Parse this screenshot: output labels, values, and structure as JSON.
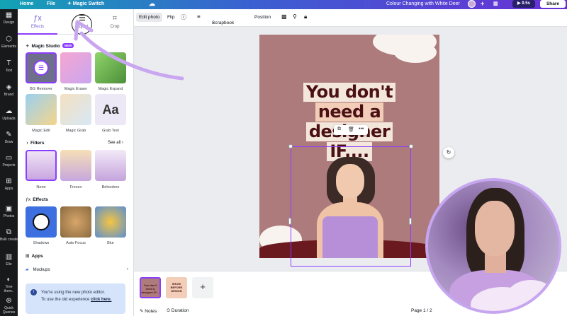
{
  "topbar": {
    "home": "Home",
    "file": "File",
    "magic_switch": "✦ Magic Switch",
    "doc_title": "Colour Changing with White Deer",
    "timer": "▶ 9.5s",
    "share": "Share"
  },
  "rail": [
    {
      "icon": "▦",
      "label": "Design"
    },
    {
      "icon": "⬡",
      "label": "Elements"
    },
    {
      "icon": "T",
      "label": "Text"
    },
    {
      "icon": "◈",
      "label": "Brand"
    },
    {
      "icon": "☁",
      "label": "Uploads"
    },
    {
      "icon": "✎",
      "label": "Draw"
    },
    {
      "icon": "▭",
      "label": "Projects"
    },
    {
      "icon": "⊞",
      "label": "Apps"
    },
    {
      "icon": "▣",
      "label": "Photos"
    },
    {
      "icon": "⧉",
      "label": "Bulk create"
    },
    {
      "icon": "▥",
      "label": "Elie"
    },
    {
      "icon": "◐",
      "label": "Tree them.."
    },
    {
      "icon": "⊛",
      "label": "Quick Queries"
    }
  ],
  "panel": {
    "tabs": [
      {
        "icon": "ƒx",
        "label": "Effects"
      },
      {
        "icon": "☰",
        "label": "Adjust"
      },
      {
        "icon": "⌗",
        "label": "Crop"
      }
    ],
    "magic_studio": {
      "title": "Magic Studio",
      "badge": "NEW",
      "items": [
        "BG Remover",
        "Magic Eraser",
        "Magic Expand",
        "Magic Edit",
        "Magic Grab",
        "Grab Text"
      ]
    },
    "filters": {
      "title": "Filters",
      "see_all": "See all",
      "items": [
        "None",
        "Fresco",
        "Belvedere"
      ]
    },
    "effects": {
      "title": "Effects",
      "items": [
        "Shadows",
        "Auto Focus",
        "Blur"
      ]
    },
    "apps": {
      "title": "Apps",
      "mockups": "Mockups"
    },
    "notice": {
      "line1": "You're using the new photo editor.",
      "line2": "To use the old experience ",
      "link": "click here."
    }
  },
  "editor_toolbar": {
    "edit_photo": "Edit photo",
    "flip": "Flip",
    "scrapbook": "Scrapbook",
    "position": "Position"
  },
  "canvas": {
    "line1": "You don't",
    "line2": "need a",
    "line3": "designer",
    "line4": "IF...."
  },
  "strip": {
    "thumb1": "You don't need a designer IF....",
    "thumb2": "SHOW BEFORE DESIGN",
    "notes": "Notes",
    "duration": "Duration",
    "page": "Page 1 / 2"
  },
  "colors": {
    "accent": "#8b3dff",
    "canvas_bg": "#ad7b7b",
    "headline": "#4a1014"
  }
}
